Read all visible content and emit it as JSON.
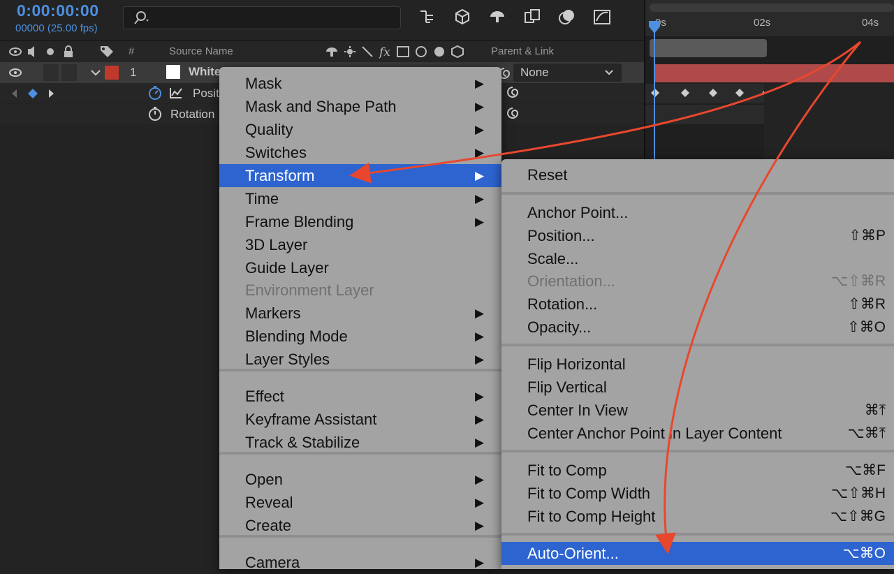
{
  "header": {
    "timecode": "0:00:00:00",
    "frames": "00000 (25.00 fps)",
    "search_icon": "search-icon"
  },
  "columns": {
    "number": "#",
    "source_name": "Source Name",
    "parent_link": "Parent & Link"
  },
  "layer": {
    "index": "1",
    "name": "White",
    "label_color": "#c0392b",
    "parent": "None"
  },
  "properties": {
    "position": "Positi",
    "rotation": "Rotation"
  },
  "timeline": {
    "ticks": [
      "0s",
      "02s",
      "04s"
    ]
  },
  "main_menu": {
    "items": [
      {
        "label": "Mask",
        "arrow": "▶"
      },
      {
        "label": "Mask and Shape Path",
        "arrow": "▶"
      },
      {
        "label": "Quality",
        "arrow": "▶"
      },
      {
        "label": "Switches",
        "arrow": "▶"
      },
      {
        "label": "Transform",
        "arrow": "▶"
      },
      {
        "label": "Time",
        "arrow": "▶"
      },
      {
        "label": "Frame Blending",
        "arrow": "▶"
      },
      {
        "label": "3D Layer",
        "arrow": ""
      },
      {
        "label": "Guide Layer",
        "arrow": ""
      },
      {
        "label": "Environment Layer",
        "arrow": ""
      },
      {
        "label": "Markers",
        "arrow": "▶"
      },
      {
        "label": "Blending Mode",
        "arrow": "▶"
      },
      {
        "label": "Layer Styles",
        "arrow": "▶"
      },
      {
        "label": "Effect",
        "arrow": "▶"
      },
      {
        "label": "Keyframe Assistant",
        "arrow": "▶"
      },
      {
        "label": "Track & Stabilize",
        "arrow": "▶"
      },
      {
        "label": "Open",
        "arrow": "▶"
      },
      {
        "label": "Reveal",
        "arrow": "▶"
      },
      {
        "label": "Create",
        "arrow": "▶"
      },
      {
        "label": "Camera",
        "arrow": "▶"
      }
    ]
  },
  "sub_menu": {
    "items": [
      {
        "label": "Reset",
        "shortcut": ""
      },
      {
        "label": "Anchor Point...",
        "shortcut": ""
      },
      {
        "label": "Position...",
        "shortcut": "⇧⌘P"
      },
      {
        "label": "Scale...",
        "shortcut": ""
      },
      {
        "label": "Orientation...",
        "shortcut": "⌥⇧⌘R"
      },
      {
        "label": "Rotation...",
        "shortcut": "⇧⌘R"
      },
      {
        "label": "Opacity...",
        "shortcut": "⇧⌘O"
      },
      {
        "label": "Flip Horizontal",
        "shortcut": ""
      },
      {
        "label": "Flip Vertical",
        "shortcut": ""
      },
      {
        "label": "Center In View",
        "shortcut": "⌘⤒"
      },
      {
        "label": "Center Anchor Point in Layer Content",
        "shortcut": "⌥⌘⤒"
      },
      {
        "label": "Fit to Comp",
        "shortcut": "⌥⌘F"
      },
      {
        "label": "Fit to Comp Width",
        "shortcut": "⌥⇧⌘H"
      },
      {
        "label": "Fit to Comp Height",
        "shortcut": "⌥⇧⌘G"
      },
      {
        "label": "Auto-Orient...",
        "shortcut": "⌥⌘O"
      }
    ]
  },
  "colors": {
    "accent": "#4d8fe0",
    "selection": "#2d64d0",
    "annotation_arrow": "#e8472e"
  }
}
